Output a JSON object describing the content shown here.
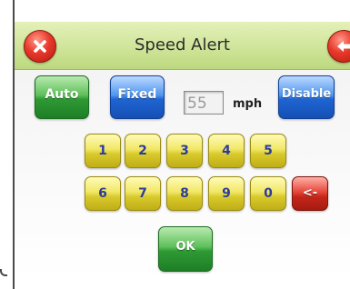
{
  "dialog": {
    "title": "Speed Alert"
  },
  "modes": {
    "auto_label": "Auto",
    "fixed_label": "Fixed",
    "disable_label": "Disable"
  },
  "speed": {
    "value": "55",
    "unit": "mph"
  },
  "keypad": {
    "row1": [
      "1",
      "2",
      "3",
      "4",
      "5"
    ],
    "row2": [
      "6",
      "7",
      "8",
      "9",
      "0"
    ],
    "backspace_label": "<-"
  },
  "ok_label": "OK",
  "icons": {
    "close": "close-x-icon",
    "back": "back-arrow-icon"
  },
  "colors": {
    "title_bar": "#cfe59a",
    "green_button": "#2e9a34",
    "blue_button": "#1f64d2",
    "yellow_key": "#d8c92c",
    "red_button": "#c4261a"
  }
}
